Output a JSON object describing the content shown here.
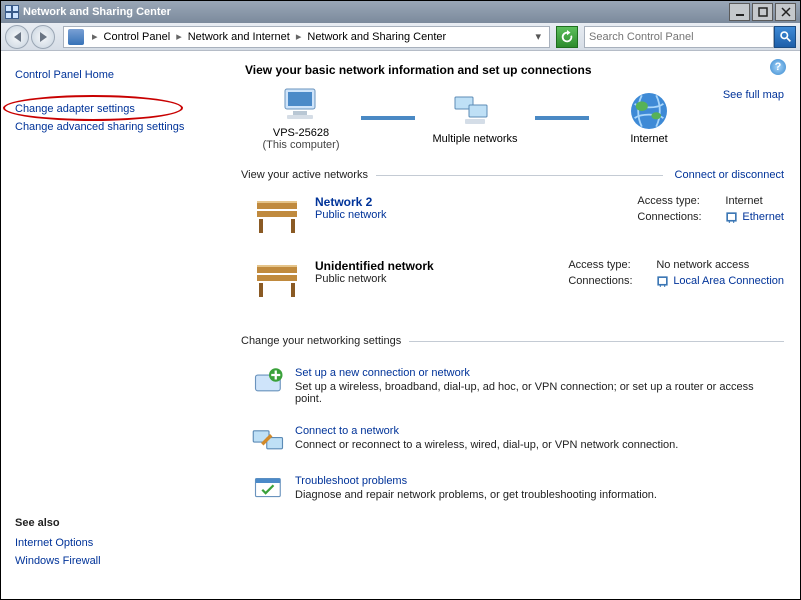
{
  "window": {
    "title": "Network and Sharing Center"
  },
  "breadcrumb": {
    "seg1": "Control Panel",
    "seg2": "Network and Internet",
    "seg3": "Network and Sharing Center"
  },
  "search": {
    "placeholder": "Search Control Panel"
  },
  "sidebar": {
    "home": "Control Panel Home",
    "items": [
      "Change adapter settings",
      "Change advanced sharing settings"
    ],
    "see_also_hd": "See also",
    "see_also": [
      "Internet Options",
      "Windows Firewall"
    ]
  },
  "main": {
    "heading": "View your basic network information and set up connections",
    "see_full_map": "See full map",
    "map": {
      "node1_label": "VPS-25628",
      "node1_sub": "(This computer)",
      "node2_label": "Multiple networks",
      "node3_label": "Internet"
    },
    "active_hd": "View your active networks",
    "active_link": "Connect or disconnect",
    "net1": {
      "name": "Network  2",
      "type": "Public network",
      "access_k": "Access type:",
      "access_v": "Internet",
      "conn_k": "Connections:",
      "conn_v": "Ethernet"
    },
    "net2": {
      "name": "Unidentified network",
      "type": "Public network",
      "access_k": "Access type:",
      "access_v": "No network access",
      "conn_k": "Connections:",
      "conn_v": "Local Area Connection"
    },
    "settings_hd": "Change your networking settings",
    "s1": {
      "title": "Set up a new connection or network",
      "desc": "Set up a wireless, broadband, dial-up, ad hoc, or VPN connection; or set up a router or access point."
    },
    "s2": {
      "title": "Connect to a network",
      "desc": "Connect or reconnect to a wireless, wired, dial-up, or VPN network connection."
    },
    "s3": {
      "title": "Troubleshoot problems",
      "desc": "Diagnose and repair network problems, or get troubleshooting information."
    }
  }
}
